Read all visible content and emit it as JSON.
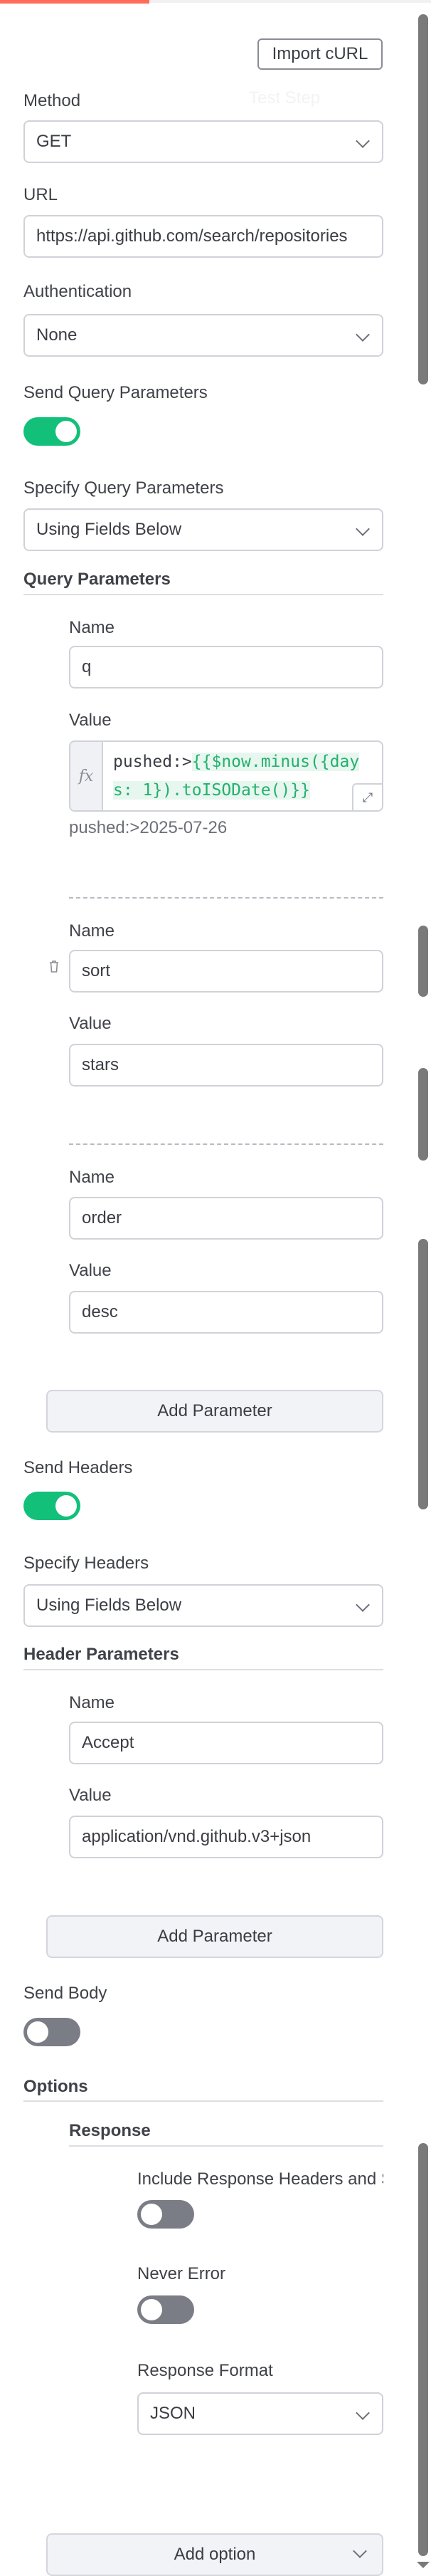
{
  "header": {
    "import_label": "Import cURL",
    "ghost_label": "Test Step"
  },
  "method": {
    "label": "Method",
    "value": "GET"
  },
  "url": {
    "label": "URL",
    "value": "https://api.github.com/search/repositories"
  },
  "authentication": {
    "label": "Authentication",
    "value": "None"
  },
  "send_query": {
    "label": "Send Query Parameters",
    "enabled": true
  },
  "specify_query": {
    "label": "Specify Query Parameters",
    "value": "Using Fields Below"
  },
  "query_params": {
    "title": "Query Parameters",
    "items": [
      {
        "name_label": "Name",
        "name": "q",
        "value_label": "Value",
        "value_static": "pushed:>",
        "value_expr": "{{$now.minus({days: 1}).toISODate()}}",
        "preview": "pushed:>2025-07-26",
        "fx": "fx"
      },
      {
        "name_label": "Name",
        "name": "sort",
        "value_label": "Value",
        "value": "stars"
      },
      {
        "name_label": "Name",
        "name": "order",
        "value_label": "Value",
        "value": "desc"
      }
    ],
    "add_label": "Add Parameter"
  },
  "send_headers": {
    "label": "Send Headers",
    "enabled": true
  },
  "specify_headers": {
    "label": "Specify Headers",
    "value": "Using Fields Below"
  },
  "header_params": {
    "title": "Header Parameters",
    "items": [
      {
        "name_label": "Name",
        "name": "Accept",
        "value_label": "Value",
        "value": "application/vnd.github.v3+json"
      }
    ],
    "add_label": "Add Parameter"
  },
  "send_body": {
    "label": "Send Body",
    "enabled": false
  },
  "options": {
    "title": "Options",
    "response": {
      "title": "Response",
      "include_headers": {
        "label": "Include Response Headers and Status",
        "enabled": false
      },
      "never_error": {
        "label": "Never Error",
        "enabled": false
      },
      "format": {
        "label": "Response Format",
        "value": "JSON"
      }
    },
    "add_option_label": "Add option"
  },
  "colors": {
    "accent": "#ff6d5a",
    "toggle_on": "#12c07a",
    "toggle_off": "#7b7d86",
    "expression": "#25b06e"
  },
  "icons": [
    "chevron-down-icon",
    "trash-icon",
    "fx-icon",
    "expand-icon"
  ]
}
